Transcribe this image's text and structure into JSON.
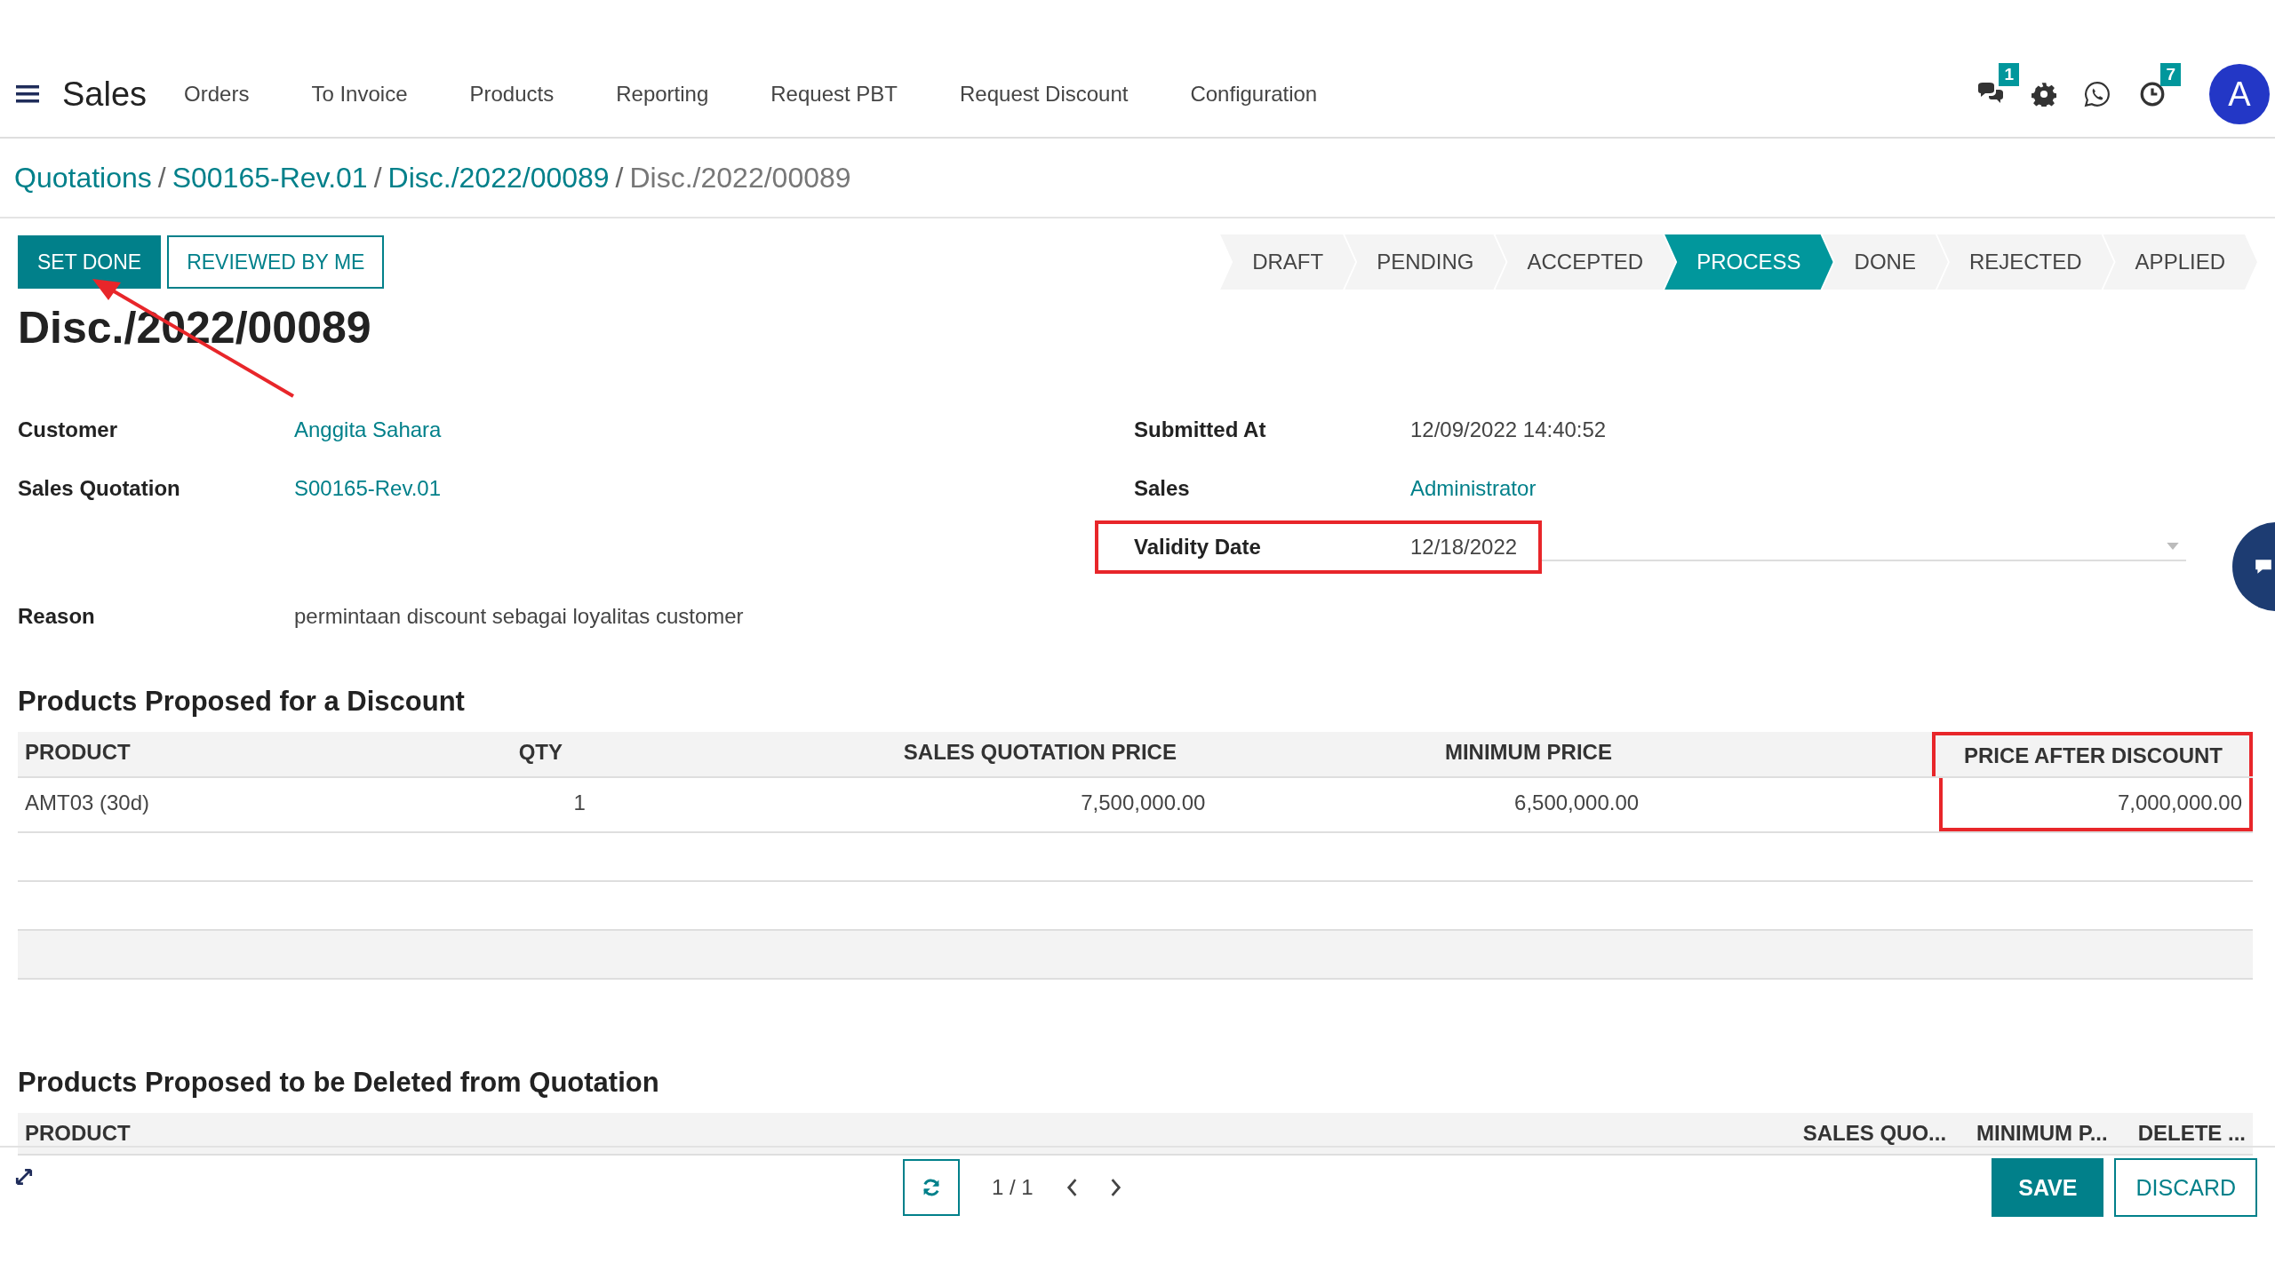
{
  "app": {
    "title": "Sales"
  },
  "menu": [
    "Orders",
    "To Invoice",
    "Products",
    "Reporting",
    "Request PBT",
    "Request Discount",
    "Configuration"
  ],
  "systray": {
    "messages_count": "1",
    "activities_count": "7",
    "avatar_initial": "A"
  },
  "breadcrumb": [
    {
      "kind": "crumb",
      "label": "Quotations",
      "link": true
    },
    {
      "kind": "separator",
      "label": "/"
    },
    {
      "kind": "crumb",
      "label": "S00165-Rev.01",
      "link": true
    },
    {
      "kind": "separator",
      "label": "/"
    },
    {
      "kind": "crumb",
      "label": "Disc./2022/00089",
      "link": true
    },
    {
      "kind": "separator",
      "label": "/"
    },
    {
      "kind": "crumb",
      "label": "Disc./2022/00089",
      "link": false
    }
  ],
  "actions": [
    {
      "label": "SET DONE",
      "primary": true
    },
    {
      "label": "REVIEWED BY ME",
      "primary": false
    }
  ],
  "stages": [
    {
      "label": "DRAFT",
      "selected": false
    },
    {
      "label": "PENDING",
      "selected": false
    },
    {
      "label": "ACCEPTED",
      "selected": false
    },
    {
      "label": "PROCESS",
      "selected": true
    },
    {
      "label": "DONE",
      "selected": false
    },
    {
      "label": "REJECTED",
      "selected": false
    },
    {
      "label": "APPLIED",
      "selected": false
    }
  ],
  "record_title": "Disc./2022/00089",
  "fields_left": [
    {
      "label": "Customer",
      "value": "Anggita Sahara",
      "kind": "link",
      "highlighted": false
    },
    {
      "label": "Sales Quotation",
      "value": "S00165-Rev.01",
      "kind": "link",
      "highlighted": false
    }
  ],
  "fields_right": [
    {
      "label": "Submitted At",
      "value": "12/09/2022 14:40:52",
      "kind": "text",
      "highlighted": false
    },
    {
      "label": "Sales",
      "value": "Administrator",
      "kind": "link",
      "highlighted": false
    },
    {
      "label": "Validity Date",
      "value": "12/18/2022",
      "kind": "date",
      "highlighted": true
    }
  ],
  "reason": {
    "label": "Reason",
    "value": "permintaan discount sebagai loyalitas customer"
  },
  "discount_table": {
    "title": "Products Proposed for a Discount",
    "columns": [
      {
        "label": "PRODUCT",
        "highlighted": false
      },
      {
        "label": "QTY",
        "highlighted": false
      },
      {
        "label": "SALES QUOTATION PRICE",
        "highlighted": false
      },
      {
        "label": "MINIMUM PRICE",
        "highlighted": false
      },
      {
        "label": "PRICE AFTER DISCOUNT",
        "highlighted": true
      }
    ],
    "rows": [
      [
        "AMT03 (30d)",
        "1",
        "7,500,000.00",
        "6,500,000.00",
        "7,000,000.00"
      ]
    ]
  },
  "deleted_table": {
    "title": "Products Proposed to be Deleted from Quotation",
    "columns": [
      "PRODUCT",
      "SALES QUO...",
      "MINIMUM P...",
      "DELETE ..."
    ]
  },
  "pager": "1 / 1",
  "footer_buttons": [
    {
      "label": "SAVE",
      "primary": true
    },
    {
      "label": "DISCARD",
      "primary": false
    }
  ]
}
